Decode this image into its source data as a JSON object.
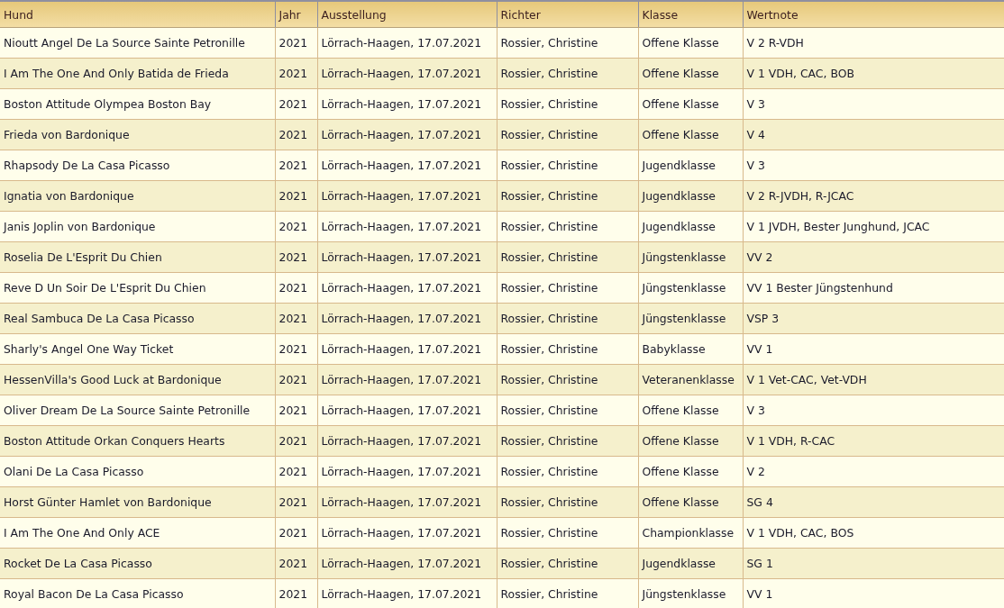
{
  "table": {
    "columns": [
      "Hund",
      "Jahr",
      "Ausstellung",
      "Richter",
      "Klasse",
      "Wertnote"
    ],
    "rows": [
      [
        "Nioutt Angel De La Source Sainte Petronille",
        "2021",
        "Lörrach-Haagen, 17.07.2021",
        "Rossier, Christine",
        "Offene Klasse",
        "V 2 R-VDH"
      ],
      [
        "I Am The One And Only Batida de Frieda",
        "2021",
        "Lörrach-Haagen, 17.07.2021",
        "Rossier, Christine",
        "Offene Klasse",
        "V 1 VDH, CAC, BOB"
      ],
      [
        "Boston Attitude Olympea Boston Bay",
        "2021",
        "Lörrach-Haagen, 17.07.2021",
        "Rossier, Christine",
        "Offene Klasse",
        "V 3"
      ],
      [
        "Frieda von Bardonique",
        "2021",
        "Lörrach-Haagen, 17.07.2021",
        "Rossier, Christine",
        "Offene Klasse",
        "V 4"
      ],
      [
        "Rhapsody De La Casa Picasso",
        "2021",
        "Lörrach-Haagen, 17.07.2021",
        "Rossier, Christine",
        "Jugendklasse",
        "V 3"
      ],
      [
        "Ignatia von Bardonique",
        "2021",
        "Lörrach-Haagen, 17.07.2021",
        "Rossier, Christine",
        "Jugendklasse",
        "V 2 R-JVDH, R-JCAC"
      ],
      [
        "Janis Joplin von Bardonique",
        "2021",
        "Lörrach-Haagen, 17.07.2021",
        "Rossier, Christine",
        "Jugendklasse",
        "V 1 JVDH, Bester Junghund, JCAC"
      ],
      [
        "Roselia De L'Esprit Du Chien",
        "2021",
        "Lörrach-Haagen, 17.07.2021",
        "Rossier, Christine",
        "Jüngstenklasse",
        "VV 2"
      ],
      [
        "Reve D Un Soir De L'Esprit Du Chien",
        "2021",
        "Lörrach-Haagen, 17.07.2021",
        "Rossier, Christine",
        "Jüngstenklasse",
        "VV 1 Bester Jüngstenhund"
      ],
      [
        "Real Sambuca De La Casa Picasso",
        "2021",
        "Lörrach-Haagen, 17.07.2021",
        "Rossier, Christine",
        "Jüngstenklasse",
        "VSP 3"
      ],
      [
        "Sharly's Angel One Way Ticket",
        "2021",
        "Lörrach-Haagen, 17.07.2021",
        "Rossier, Christine",
        "Babyklasse",
        "VV 1"
      ],
      [
        "HessenVilla's Good Luck at Bardonique",
        "2021",
        "Lörrach-Haagen, 17.07.2021",
        "Rossier, Christine",
        "Veteranenklasse",
        "V 1 Vet-CAC, Vet-VDH"
      ],
      [
        "Oliver Dream De La Source Sainte Petronille",
        "2021",
        "Lörrach-Haagen, 17.07.2021",
        "Rossier, Christine",
        "Offene Klasse",
        "V 3"
      ],
      [
        "Boston Attitude Orkan Conquers Hearts",
        "2021",
        "Lörrach-Haagen, 17.07.2021",
        "Rossier, Christine",
        "Offene Klasse",
        "V 1 VDH, R-CAC"
      ],
      [
        "Olani De La Casa Picasso",
        "2021",
        "Lörrach-Haagen, 17.07.2021",
        "Rossier, Christine",
        "Offene Klasse",
        "V 2"
      ],
      [
        "Horst Günter Hamlet von Bardonique",
        "2021",
        "Lörrach-Haagen, 17.07.2021",
        "Rossier, Christine",
        "Offene Klasse",
        "SG 4"
      ],
      [
        "I Am The One And Only ACE",
        "2021",
        "Lörrach-Haagen, 17.07.2021",
        "Rossier, Christine",
        "Championklasse",
        "V 1 VDH, CAC, BOS"
      ],
      [
        "Rocket De La Casa Picasso",
        "2021",
        "Lörrach-Haagen, 17.07.2021",
        "Rossier, Christine",
        "Jugendklasse",
        "SG 1"
      ],
      [
        "Royal Bacon De La Casa Picasso",
        "2021",
        "Lörrach-Haagen, 17.07.2021",
        "Rossier, Christine",
        "Jüngstenklasse",
        "VV 1"
      ]
    ]
  }
}
